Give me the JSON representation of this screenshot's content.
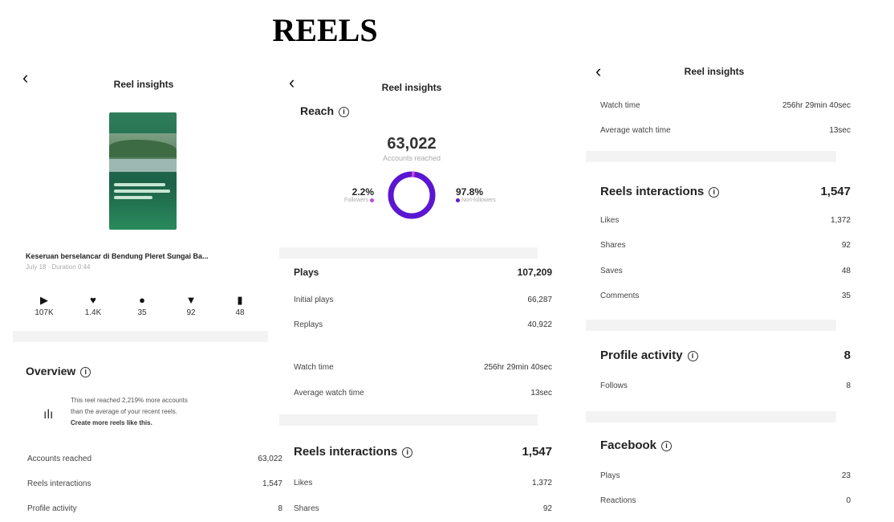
{
  "page_title": "REELS",
  "header_title": "Reel insights",
  "panel1": {
    "reel_title": "Keseruan berselancar di Bendung Pleret Sungai Ba...",
    "reel_meta": "July 18 · Duration 0:44",
    "stats": [
      {
        "icon": "play-icon",
        "glyph": "▶",
        "value": "107K"
      },
      {
        "icon": "heart-icon",
        "glyph": "♥",
        "value": "1.4K"
      },
      {
        "icon": "comment-icon",
        "glyph": "●",
        "value": "35"
      },
      {
        "icon": "share-icon",
        "glyph": "▼",
        "value": "92"
      },
      {
        "icon": "bookmark-icon",
        "glyph": "▮",
        "value": "48"
      }
    ],
    "overview_title": "Overview",
    "info_lines": [
      "This reel reached 2,219% more accounts",
      "than the average of your recent reels."
    ],
    "info_cta": "Create more reels like this.",
    "rows": [
      {
        "label": "Accounts reached",
        "value": "63,022"
      },
      {
        "label": "Reels interactions",
        "value": "1,547"
      },
      {
        "label": "Profile activity",
        "value": "8"
      }
    ]
  },
  "panel2": {
    "reach_title": "Reach",
    "reach_value": "63,022",
    "reach_label": "Accounts reached",
    "followers_pct": "2.2%",
    "followers_label": "Followers",
    "followers_fraction": 0.022,
    "nonfollowers_pct": "97.8%",
    "nonfollowers_label": "Non-followers",
    "plays": {
      "label": "Plays",
      "value": "107,209"
    },
    "plays_rows": [
      {
        "label": "Initial plays",
        "value": "66,287"
      },
      {
        "label": "Replays",
        "value": "40,922"
      }
    ],
    "watch_rows": [
      {
        "label": "Watch time",
        "value": "256hr 29min 40sec"
      },
      {
        "label": "Average watch time",
        "value": "13sec"
      }
    ],
    "interactions": {
      "label": "Reels interactions",
      "value": "1,547"
    },
    "interaction_rows": [
      {
        "label": "Likes",
        "value": "1,372"
      },
      {
        "label": "Shares",
        "value": "92"
      }
    ]
  },
  "panel3": {
    "watch_rows": [
      {
        "label": "Watch time",
        "value": "256hr 29min 40sec"
      },
      {
        "label": "Average watch time",
        "value": "13sec"
      }
    ],
    "interactions": {
      "label": "Reels interactions",
      "value": "1,547"
    },
    "interaction_rows": [
      {
        "label": "Likes",
        "value": "1,372"
      },
      {
        "label": "Shares",
        "value": "92"
      },
      {
        "label": "Saves",
        "value": "48"
      },
      {
        "label": "Comments",
        "value": "35"
      }
    ],
    "profile": {
      "label": "Profile activity",
      "value": "8"
    },
    "profile_rows": [
      {
        "label": "Follows",
        "value": "8"
      }
    ],
    "facebook": {
      "label": "Facebook"
    },
    "facebook_rows": [
      {
        "label": "Plays",
        "value": "23"
      },
      {
        "label": "Reactions",
        "value": "0"
      }
    ]
  },
  "colors": {
    "accent": "#5b16d1",
    "followers_dot": "#c24bd6"
  }
}
